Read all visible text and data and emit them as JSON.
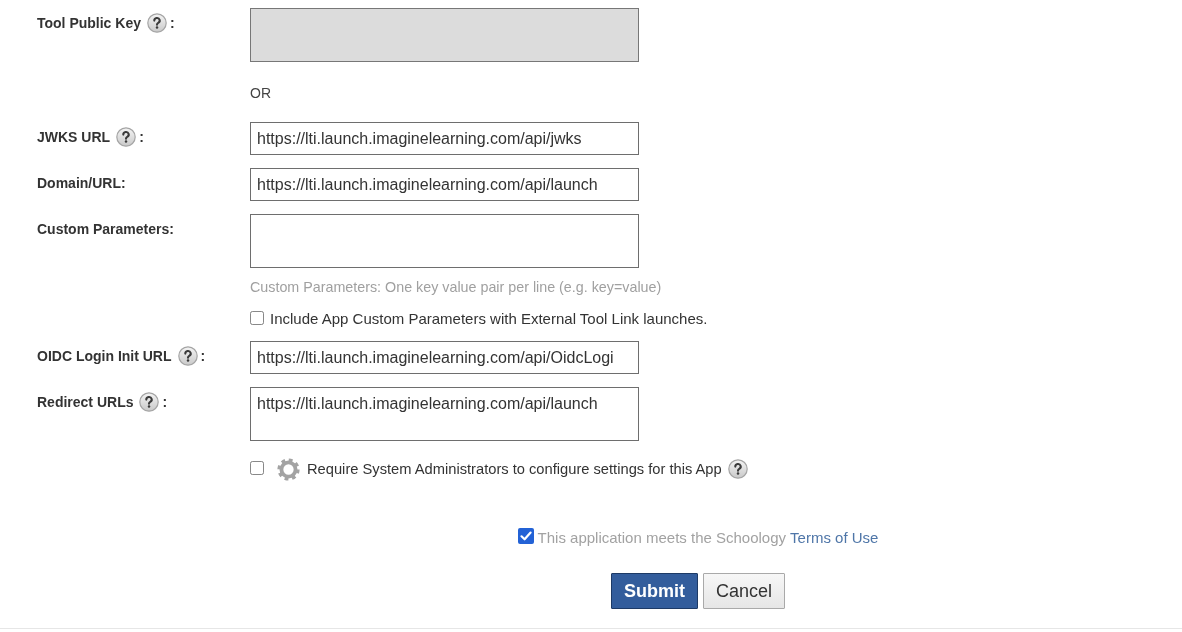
{
  "form": {
    "rows": [
      {
        "kind": "textarea",
        "label": "Tool Public Key",
        "help": true,
        "suffix": ":",
        "disabled": true
      },
      {
        "kind": "note",
        "text": "OR"
      },
      {
        "kind": "input",
        "label": "JWKS URL",
        "help": true,
        "suffix": ":",
        "value": "https://lti.launch.imaginelearning.com/api/jwks",
        "disabled": false
      },
      {
        "kind": "input",
        "label": "Domain/URL:",
        "help": false,
        "value": "https://lti.launch.imaginelearning.com/api/launch",
        "disabled": false
      },
      {
        "kind": "textarea",
        "label": "Custom Parameters:",
        "help": false,
        "disabled": false
      },
      {
        "kind": "hint",
        "text": "Custom Parameters: One key value pair per line (e.g. key=value)"
      },
      {
        "kind": "checkbox",
        "label": "Include App Custom Parameters with External Tool Link launches.",
        "checked": false,
        "gear": false,
        "help": false
      },
      {
        "kind": "input",
        "label": "OIDC Login Init URL",
        "help": true,
        "suffix": ":",
        "value": "https://lti.launch.imaginelearning.com/api/OidcLogi",
        "disabled": false
      },
      {
        "kind": "textarea",
        "label": "Redirect URLs",
        "help": true,
        "suffix": ":",
        "value": "https://lti.launch.imaginelearning.com/api/launch",
        "disabled": false
      },
      {
        "kind": "checkbox",
        "label": "Require System Administrators to configure settings for this App",
        "checked": false,
        "gear": true,
        "help": true
      }
    ]
  },
  "terms": {
    "checked": true,
    "text": "This application meets the Schoology",
    "link": "Terms of Use"
  },
  "buttons": [
    {
      "label": "Submit",
      "kind": "primary"
    },
    {
      "label": "Cancel",
      "kind": "secondary"
    }
  ]
}
